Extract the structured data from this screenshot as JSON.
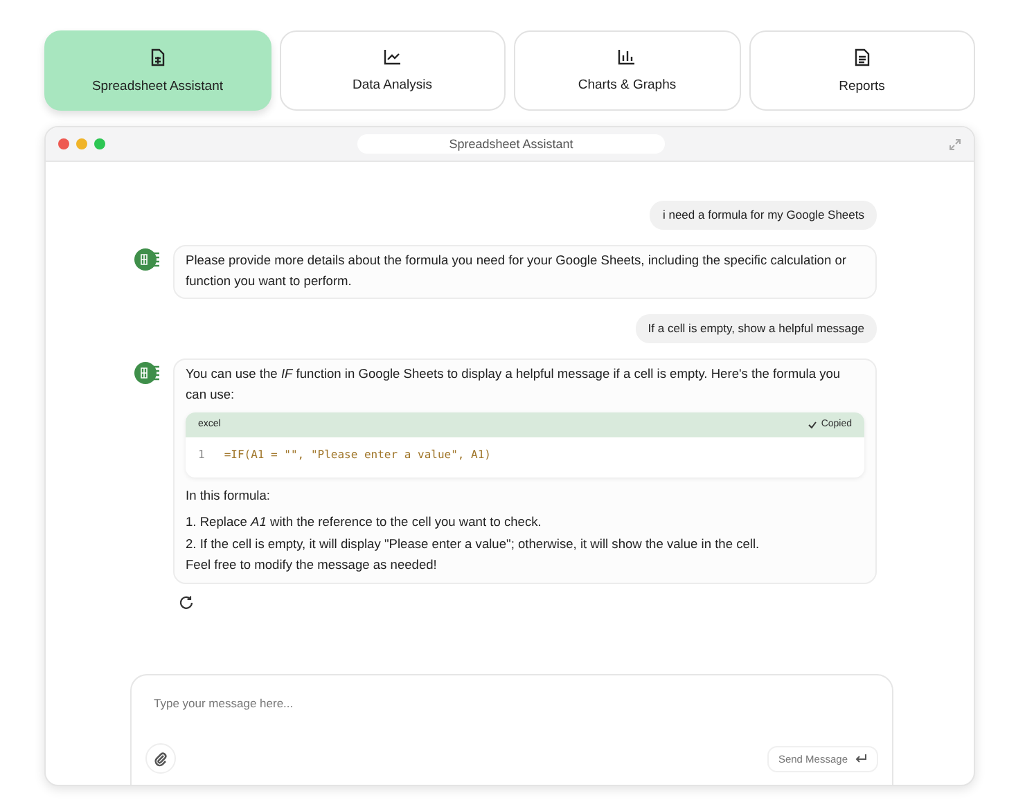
{
  "tabs": [
    {
      "label": "Spreadsheet Assistant",
      "selected": true
    },
    {
      "label": "Data Analysis",
      "selected": false
    },
    {
      "label": "Charts & Graphs",
      "selected": false
    },
    {
      "label": "Reports",
      "selected": false
    }
  ],
  "window": {
    "title": "Spreadsheet Assistant"
  },
  "messages": [
    {
      "kind": "user",
      "text": "i need a formula for my Google Sheets"
    },
    {
      "kind": "assistant",
      "blocks": [
        {
          "kind": "paragraph",
          "text": "Please provide more details about the formula you need for your Google Sheets, including the specific calculation or function you want to perform."
        }
      ]
    },
    {
      "kind": "user",
      "text": "If a cell is empty, show a helpful message"
    },
    {
      "kind": "assistant",
      "regenerate": true,
      "blocks": [
        {
          "kind": "paragraph",
          "text": "You can use the *IF* function in Google Sheets to display a helpful message if a cell is empty. Here's the formula you can use:"
        },
        {
          "kind": "code",
          "language": "excel",
          "copy_label": "Copied",
          "lines": [
            {
              "number": "1",
              "code": "=IF(A1 = \"\", \"Please enter a value\", A1)"
            }
          ]
        },
        {
          "kind": "paragraph",
          "text": "In this formula:"
        },
        {
          "kind": "paragraph",
          "text": "1. Replace *A1* with the reference to the cell you want to check."
        },
        {
          "kind": "line",
          "text": "2. If the cell is empty, it will display \"Please enter a value\"; otherwise, it will show the value in the cell."
        },
        {
          "kind": "line",
          "text": "Feel free to modify the message as needed!"
        }
      ]
    }
  ],
  "composer": {
    "placeholder": "Type your message here...",
    "send_label": "Send Message"
  }
}
